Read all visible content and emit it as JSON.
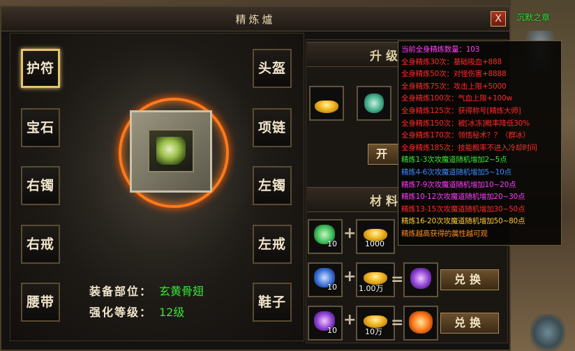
{
  "window": {
    "title": "精炼爐",
    "close_label": "X"
  },
  "npc": {
    "name": "沉默之章"
  },
  "equipment_slots": {
    "left": [
      "护符",
      "宝石",
      "右镯",
      "右戒",
      "腰带"
    ],
    "right": [
      "头盔",
      "项链",
      "左镯",
      "左戒",
      "鞋子"
    ],
    "selected": "护符"
  },
  "info": {
    "part_label": "装备部位：",
    "part_value": "玄黄骨翅",
    "level_label": "强化等级：",
    "level_value": "12级"
  },
  "upgrade_section": {
    "title": "升级",
    "start_button": "开"
  },
  "materials_section": {
    "title": "材料",
    "rows": [
      {
        "gem_count": "10",
        "gold_count": "1000",
        "gem_color": "#3fbf5a"
      },
      {
        "gem_count": "10",
        "gold_count": "1.00万",
        "gem_color": "#3a6fd8",
        "button": "兑换"
      },
      {
        "gem_count": "10",
        "gold_count": "10万",
        "gem_color": "#8a3fd0",
        "button": "兑换"
      }
    ]
  },
  "tooltip": {
    "lines": [
      {
        "text": "当前全身精炼数量：103",
        "color": "#ff3cff"
      },
      {
        "text": "全身精炼30次：基础吸血+888",
        "color": "#ff2a2a"
      },
      {
        "text": "全身精炼50次：对怪伤害+8888",
        "color": "#ff2a2a"
      },
      {
        "text": "全身精炼75次：攻击上限+5000",
        "color": "#ff2a2a"
      },
      {
        "text": "全身精炼100次：气血上限+100w",
        "color": "#ff2a2a"
      },
      {
        "text": "全身精炼125次：获得称号[精炼大师]",
        "color": "#ff2a2a"
      },
      {
        "text": "全身精炼150次：被[冰冻]概率降低30%",
        "color": "#ff2a2a"
      },
      {
        "text": "全身精炼170次：领悟秘术？？（群冰）",
        "color": "#ff2a2a"
      },
      {
        "text": "全身精炼185次：技能概率不进入冷却时间",
        "color": "#ff2a2a"
      },
      {
        "text": "精炼1-3次攻魔道随机增加2~5点",
        "color": "#3ce83c"
      },
      {
        "text": "精炼4-6次攻魔道随机增加5~10点",
        "color": "#3a8cff"
      },
      {
        "text": "精炼7-9次攻魔道随机增加10~20点",
        "color": "#ff3cff"
      },
      {
        "text": "精炼10-12次攻魔道随机增加20~30点",
        "color": "#ff3cff"
      },
      {
        "text": "精炼13-15次攻魔道随机增加30~50点",
        "color": "#ff2a2a"
      },
      {
        "text": "精炼16-20次攻魔道随机增加50~80点",
        "color": "#ffcc33"
      },
      {
        "text": "精炼越高获得的属性越可观",
        "color": "#ff8a1a"
      }
    ]
  }
}
